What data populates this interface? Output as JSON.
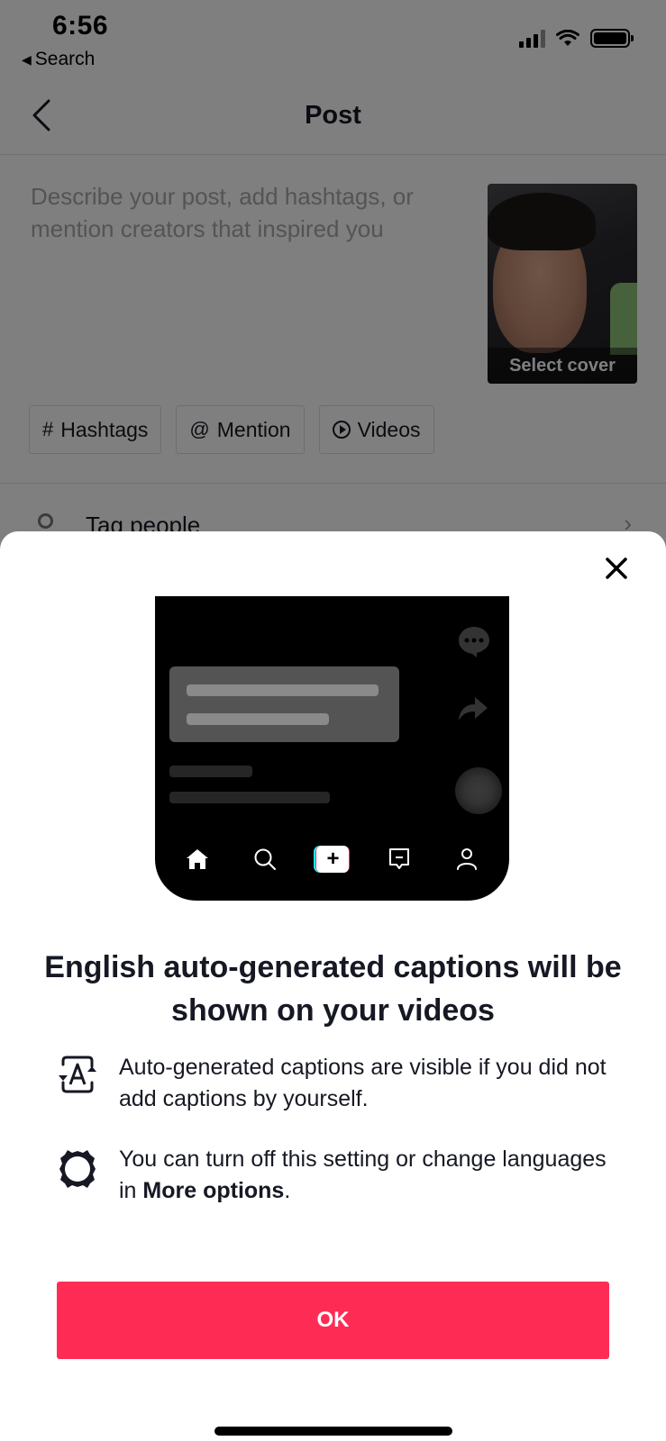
{
  "status_bar": {
    "time": "6:56",
    "back_app_label": "Search",
    "icons": [
      "cellular-signal-icon",
      "wifi-icon",
      "battery-icon"
    ]
  },
  "nav": {
    "title": "Post",
    "back_icon": "chevron-left-icon"
  },
  "post_form": {
    "description_placeholder": "Describe your post, add hashtags, or mention creators that inspired you",
    "cover_label": "Select cover",
    "chips": [
      {
        "icon": "#",
        "label": "Hashtags"
      },
      {
        "icon": "@",
        "label": "Mention"
      },
      {
        "icon": "play-circle-icon",
        "label": "Videos"
      }
    ],
    "rows": [
      {
        "icon": "person-icon",
        "label": "Tag people"
      }
    ]
  },
  "sheet": {
    "close_icon": "close-icon",
    "illustration": {
      "tabs": [
        "home-icon",
        "search-icon",
        "create-plus-icon",
        "inbox-icon",
        "profile-icon"
      ],
      "plus_label": "+",
      "accent_colors": {
        "cyan": "#25f4ee",
        "red": "#fe2c55"
      }
    },
    "headline": "English auto-generated captions will be shown on your videos",
    "items": [
      {
        "icon": "auto-captions-icon",
        "text": "Auto-generated captions are visible if you did not add captions by yourself."
      },
      {
        "icon": "settings-gear-icon",
        "text_before": "You can turn off this setting or change languages in ",
        "text_bold": "More options",
        "text_after": "."
      }
    ],
    "ok_label": "OK",
    "ok_color": "#fe2c55"
  }
}
